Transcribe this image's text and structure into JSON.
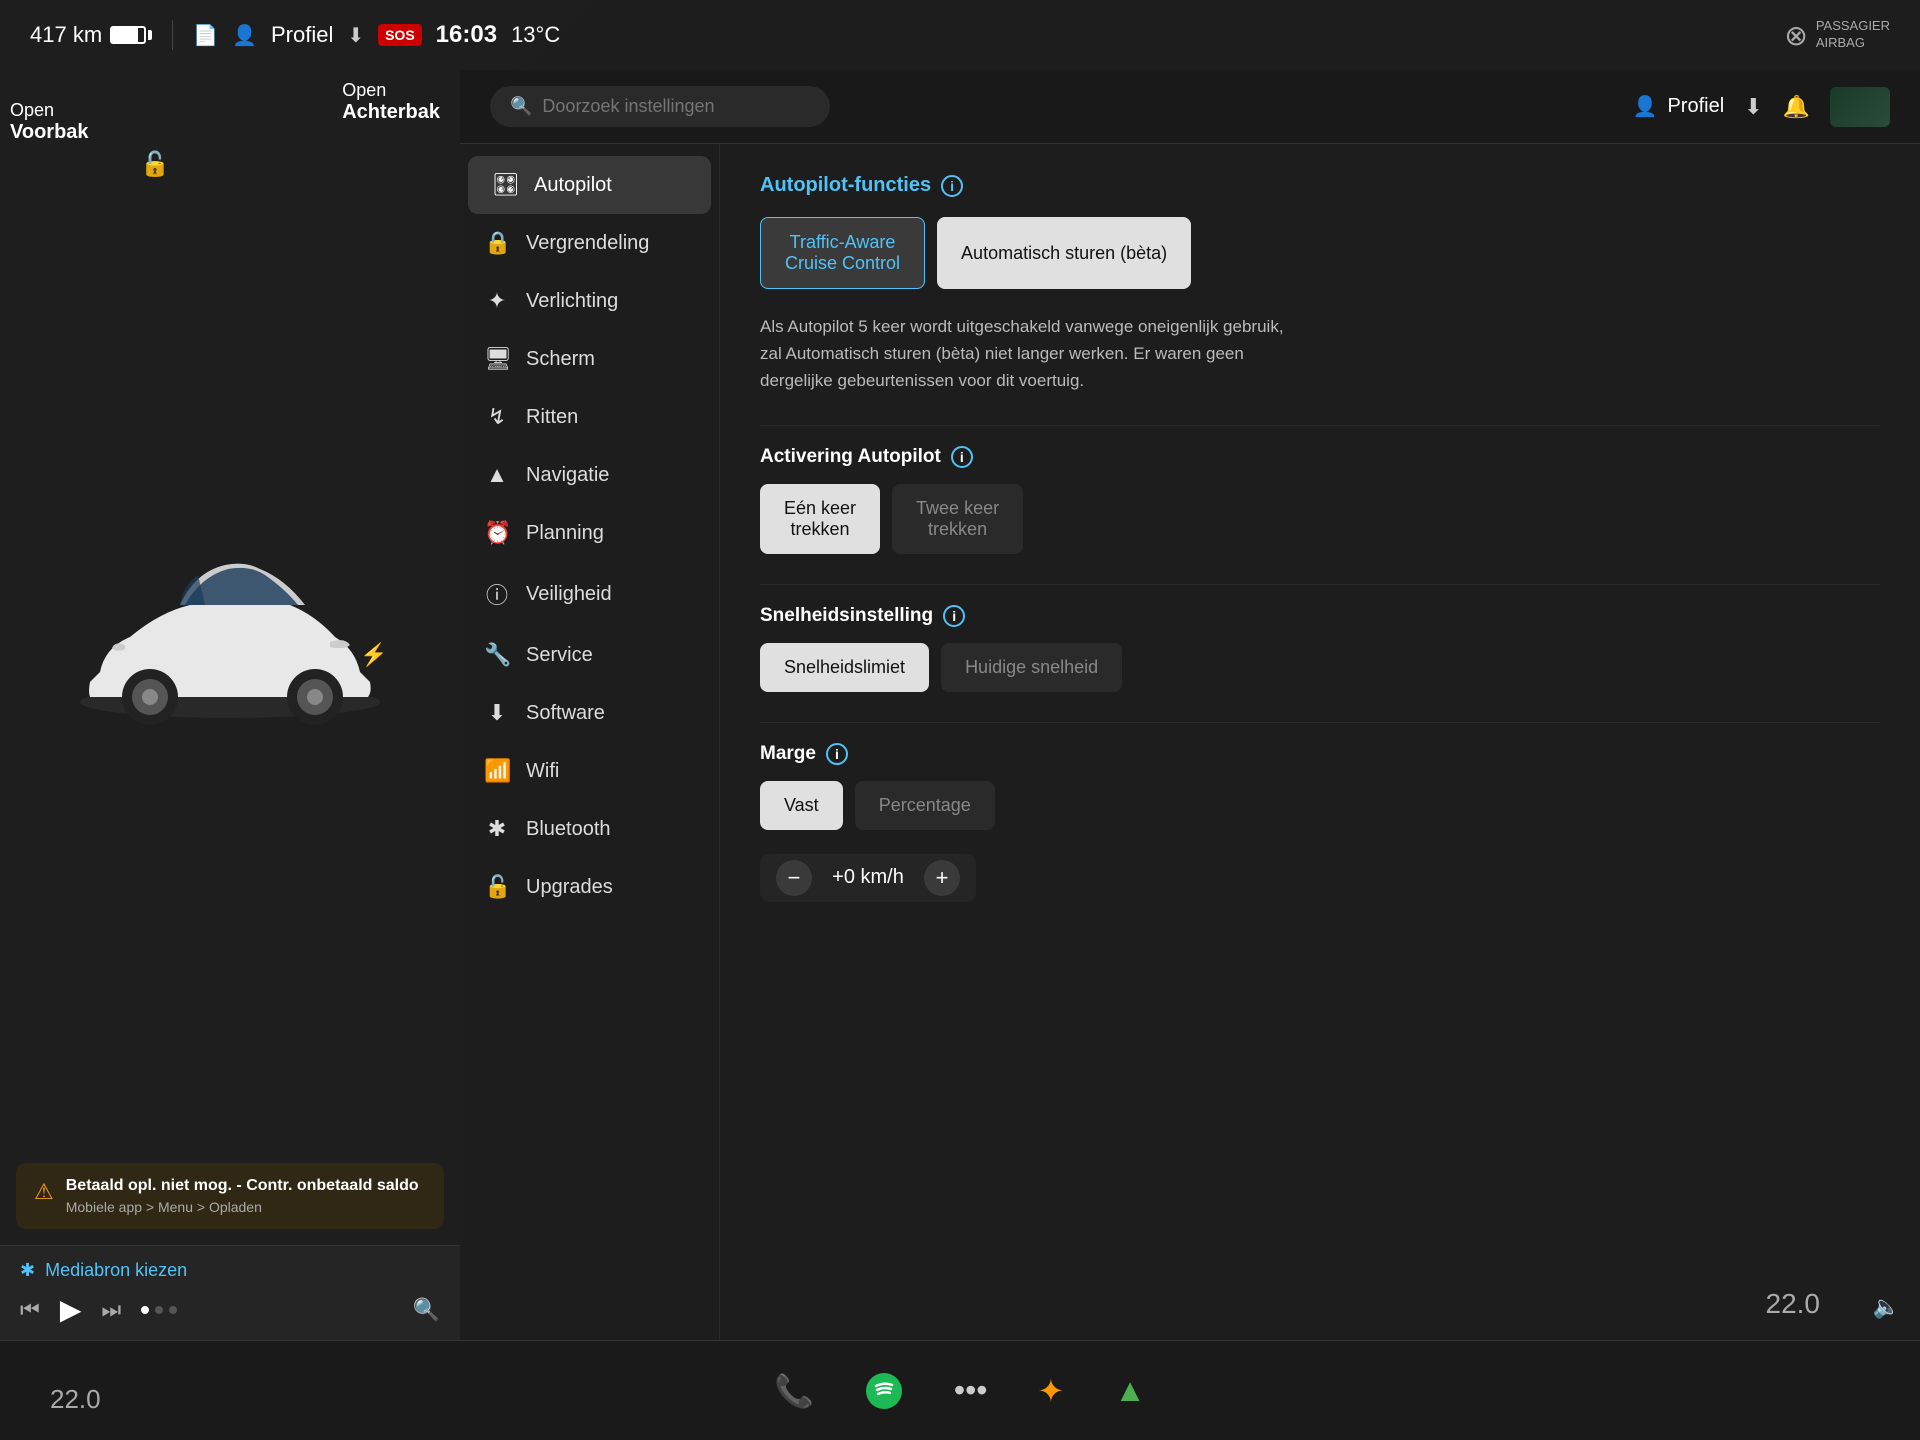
{
  "status_bar": {
    "range": "417 km",
    "separator1": "",
    "profile_label": "Profiel",
    "download_icon": "⬇",
    "sos_label": "SOS",
    "time": "16:03",
    "temperature": "13°C",
    "passenger_airbag_label": "PASSAGIER\nAIRBAG"
  },
  "car_view": {
    "label_front": "Open",
    "label_front_bold": "Voorbak",
    "label_rear": "Open",
    "label_rear_bold": "Achterbak"
  },
  "warning": {
    "title": "Betaald opl. niet mog. - Contr. onbetaald saldo",
    "subtitle": "Mobiele app > Menu > Opladen"
  },
  "media": {
    "source_label": "Mediabron kiezen"
  },
  "taskbar": {
    "temp_left": "22.0",
    "temp_right": "22.0"
  },
  "settings": {
    "search_placeholder": "Doorzoek instellingen",
    "profile_label": "Profiel",
    "menu_items": [
      {
        "id": "autopilot",
        "icon": "🎛",
        "label": "Autopilot",
        "active": true
      },
      {
        "id": "vergrendeling",
        "icon": "🔒",
        "label": "Vergrendeling",
        "active": false
      },
      {
        "id": "verlichting",
        "icon": "✦",
        "label": "Verlichting",
        "active": false
      },
      {
        "id": "scherm",
        "icon": "🖥",
        "label": "Scherm",
        "active": false
      },
      {
        "id": "ritten",
        "icon": "↯",
        "label": "Ritten",
        "active": false
      },
      {
        "id": "navigatie",
        "icon": "▲",
        "label": "Navigatie",
        "active": false
      },
      {
        "id": "planning",
        "icon": "⏰",
        "label": "Planning",
        "active": false
      },
      {
        "id": "veiligheid",
        "icon": "⓪",
        "label": "Veiligheid",
        "active": false
      },
      {
        "id": "service",
        "icon": "🔧",
        "label": "Service",
        "active": false
      },
      {
        "id": "software",
        "icon": "⬇",
        "label": "Software",
        "active": false
      },
      {
        "id": "wifi",
        "icon": "📶",
        "label": "Wifi",
        "active": false
      },
      {
        "id": "bluetooth",
        "icon": "✱",
        "label": "Bluetooth",
        "active": false
      },
      {
        "id": "upgrades",
        "icon": "🔓",
        "label": "Upgrades",
        "active": false
      }
    ],
    "content": {
      "autopilot_functions_label": "Autopilot-functies",
      "btn_traffic_aware": "Traffic-Aware\nCruise Control",
      "btn_auto_steer": "Automatisch sturen (bèta)",
      "description": "Als Autopilot 5 keer wordt uitgeschakeld vanwege oneigenlijk gebruik, zal Automatisch sturen (bèta) niet langer werken. Er waren geen dergelijke gebeurtenissen voor dit voertuig.",
      "activering_label": "Activering Autopilot",
      "btn_een_keer": "Eén keer\ntrekken",
      "btn_twee_keer": "Twee keer\ntrekken",
      "snelheid_label": "Snelheidsinstelling",
      "btn_snelheidslimiet": "Snelheidslimiet",
      "btn_huidige_snelheid": "Huidige snelheid",
      "marge_label": "Marge",
      "btn_vast": "Vast",
      "btn_percentage": "Percentage",
      "speed_minus": "−",
      "speed_value": "+0 km/h",
      "speed_plus": "+"
    }
  }
}
